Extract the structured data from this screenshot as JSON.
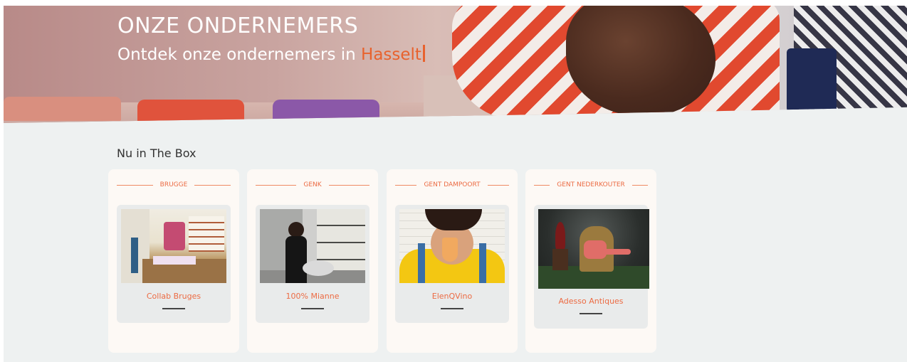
{
  "hero": {
    "title": "ONZE ONDERNEMERS",
    "subtitle_prefix": "Ontdek onze ondernemers in",
    "city": "Hasselt"
  },
  "section": {
    "title": "Nu in The Box"
  },
  "cards": [
    {
      "location": "BRUGGE",
      "name": "Collab Bruges"
    },
    {
      "location": "GENK",
      "name": "100% Mianne"
    },
    {
      "location": "GENT DAMPOORT",
      "name": "ElenQVino"
    },
    {
      "location": "GENT NEDERKOUTER",
      "name": "Adesso Antiques"
    }
  ],
  "colors": {
    "accent": "#ec6b43",
    "background": "#eef1f1",
    "card": "#fdf9f5"
  }
}
